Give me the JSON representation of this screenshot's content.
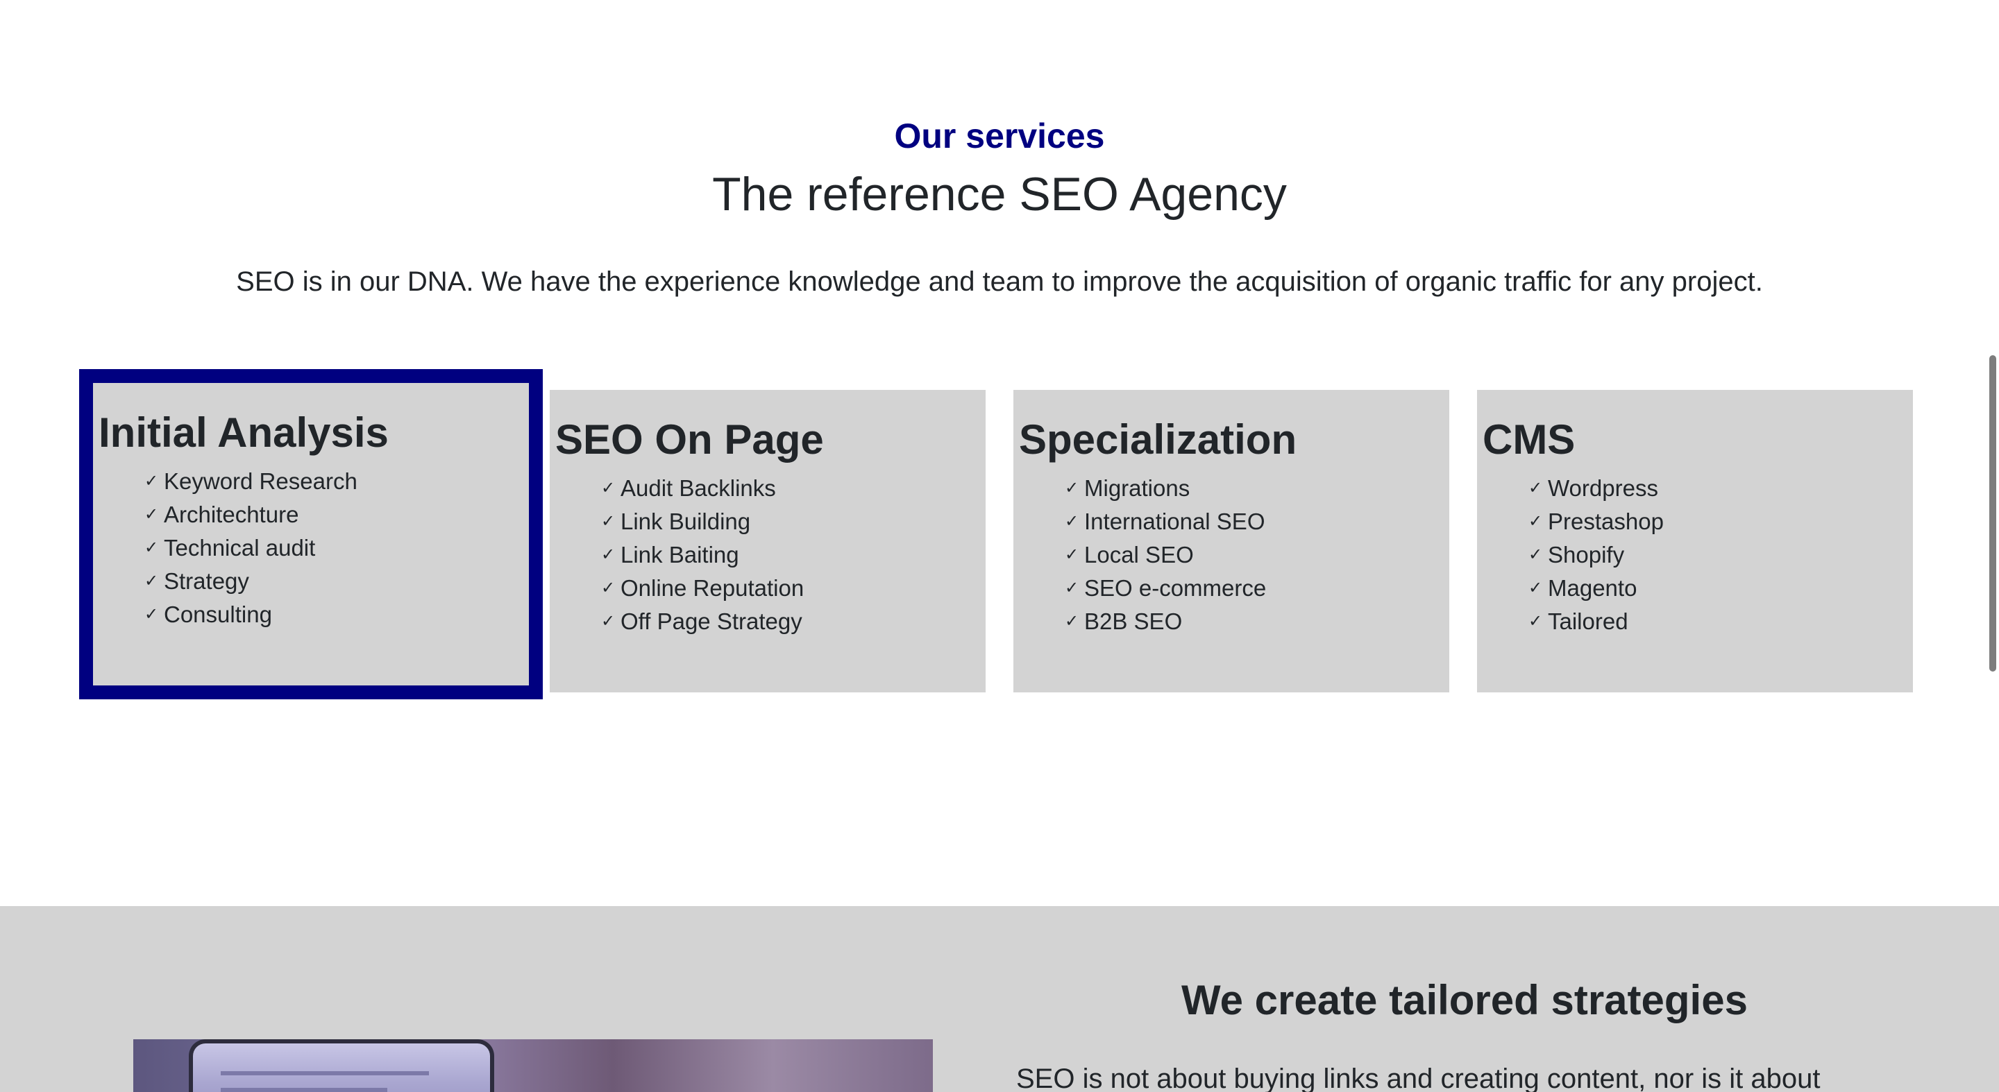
{
  "services": {
    "eyebrow": "Our services",
    "headline": "The reference SEO Agency",
    "intro": "SEO is in our DNA. We have the experience knowledge and team to improve the acquisition of organic traffic for any project."
  },
  "cards": [
    {
      "title": "Initial Analysis",
      "selected": true,
      "items": [
        "Keyword Research",
        "Architechture",
        "Technical audit",
        "Strategy",
        "Consulting"
      ]
    },
    {
      "title": "SEO On Page",
      "selected": false,
      "items": [
        "Audit Backlinks",
        "Link Building",
        "Link Baiting",
        "Online Reputation",
        "Off Page Strategy"
      ]
    },
    {
      "title": "Specialization",
      "selected": false,
      "items": [
        "Migrations",
        "International SEO",
        "Local SEO",
        "SEO e-commerce",
        "B2B SEO"
      ]
    },
    {
      "title": "CMS",
      "selected": false,
      "items": [
        "Wordpress",
        "Prestashop",
        "Shopify",
        "Magento",
        "Tailored"
      ]
    }
  ],
  "check_glyph": "✓",
  "strategies": {
    "title": "We create tailored strategies",
    "text": "SEO is not about buying links and creating content, nor is it about"
  },
  "colors": {
    "accent": "#000080",
    "card_bg": "#d3d3d3",
    "text": "#212529",
    "section_bg": "#d3d3d3"
  },
  "icons": {
    "check": "check-icon",
    "photo": "laptop-photo"
  }
}
